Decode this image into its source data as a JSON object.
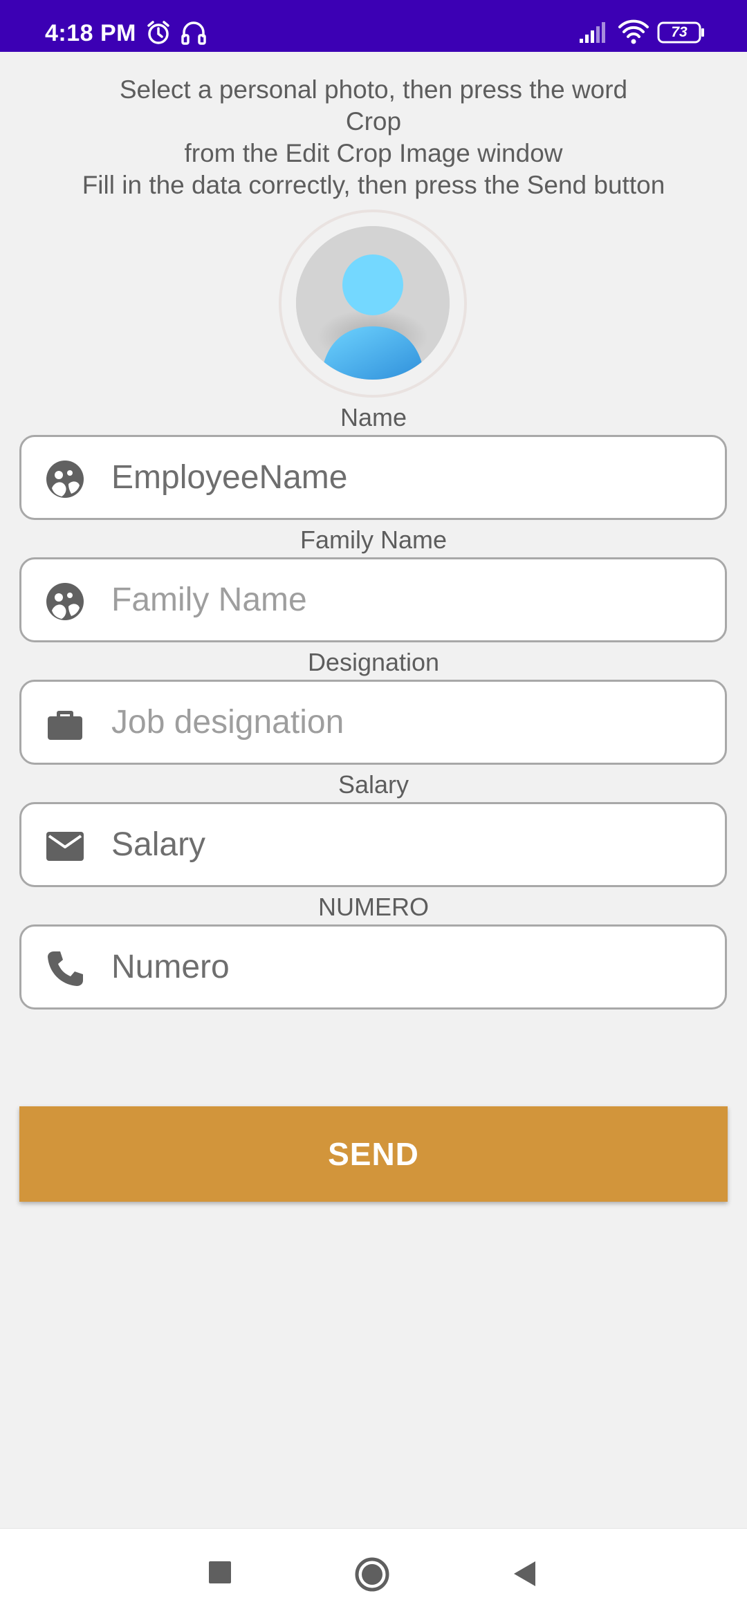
{
  "status_bar": {
    "time": "4:18 PM",
    "battery": "73",
    "icons": [
      "alarm-icon",
      "headset-icon",
      "signal-icon",
      "wifi-icon",
      "battery-icon"
    ]
  },
  "instructions": {
    "line1": "Select a personal photo, then press the word",
    "line2": "Crop",
    "line3": "from the Edit Crop Image window",
    "line4": "Fill in the data correctly, then press the Send button"
  },
  "form": {
    "name_label": "Name",
    "name_value": "EmployeeName",
    "family_label": "Family Name",
    "family_placeholder": "Family Name",
    "designation_label": "Designation",
    "designation_placeholder": "Job designation",
    "salary_label": "Salary",
    "salary_value": "Salary",
    "numero_label": "NUMERO",
    "numero_value": "Numero",
    "send_label": "SEND"
  },
  "colors": {
    "status_bar": "#3c00b4",
    "background": "#f1f1f1",
    "send_button": "#d2953b",
    "avatar_head": "#74d8ff",
    "avatar_body": "#3aa0e6",
    "icon": "#616161"
  },
  "nav": {
    "icons": [
      "recent-apps-icon",
      "home-icon",
      "back-icon"
    ]
  }
}
